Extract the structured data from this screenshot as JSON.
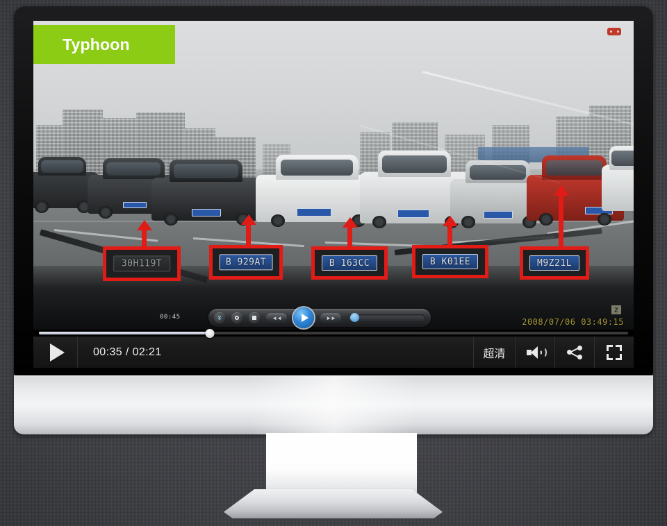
{
  "banner": {
    "label": "Typhoon"
  },
  "video": {
    "rec_badge": "record-badge",
    "dashcam_timestamp": "2008/07/06 03:49:15",
    "dashcam_logo": "Z",
    "inner_player": {
      "time": "00:45",
      "buttons": [
        {
          "name": "dash-capture-button",
          "glyph": "¥"
        },
        {
          "name": "dash-record-button",
          "glyph": ""
        },
        {
          "name": "dash-stop-button",
          "glyph": ""
        },
        {
          "name": "dash-rewind-button",
          "glyph": "◄◄"
        },
        {
          "name": "dash-play-button",
          "glyph": "▶"
        },
        {
          "name": "dash-forward-button",
          "glyph": "►►"
        }
      ]
    },
    "plate_callouts": [
      {
        "id": 1,
        "text": "30H119T",
        "dark": true
      },
      {
        "id": 2,
        "text": "B 929AT",
        "dark": false
      },
      {
        "id": 3,
        "text": "B 163CC",
        "dark": false
      },
      {
        "id": 4,
        "text": "B K01EE",
        "dark": false
      },
      {
        "id": 5,
        "text": "M9Z21L",
        "dark": false
      }
    ]
  },
  "player": {
    "play_label": "play-button",
    "time_display": "00:35 / 02:21",
    "current_time": "00:35",
    "duration": "02:21",
    "progress_percent": 29,
    "quality_label": "超清",
    "volume_label": "volume-button",
    "share_label": "share-button",
    "fullscreen_label": "fullscreen-button"
  },
  "colors": {
    "banner_green": "#8ccc14",
    "callout_red": "#e11b16",
    "background": "#45464b",
    "plate_blue": "#2a58a8",
    "timestamp_yellow": "#b9a93c"
  }
}
